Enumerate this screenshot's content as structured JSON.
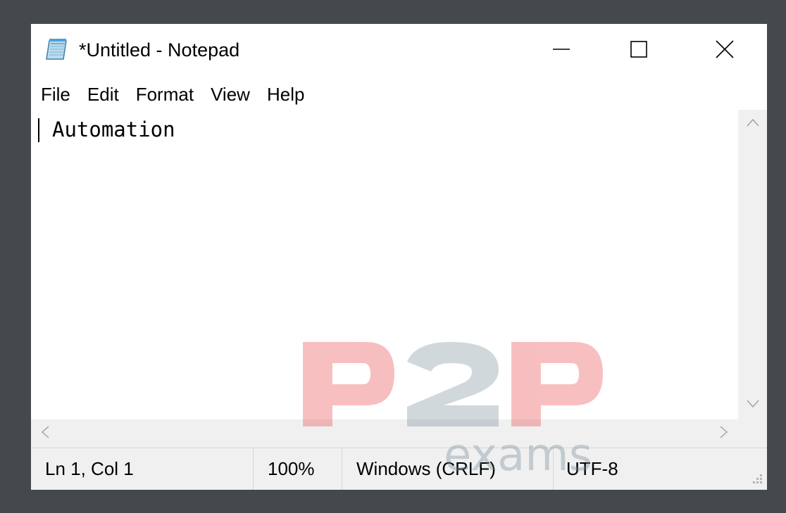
{
  "window": {
    "title": "*Untitled - Notepad"
  },
  "icons": {
    "app": "notepad-icon",
    "minimize": "minimize-icon",
    "maximize": "maximize-icon",
    "close": "close-icon",
    "scroll_up": "chevron-up-icon",
    "scroll_down": "chevron-down-icon",
    "scroll_left": "chevron-left-icon",
    "scroll_right": "chevron-right-icon",
    "grip": "resize-grip-icon"
  },
  "menu": {
    "items": [
      "File",
      "Edit",
      "Format",
      "View",
      "Help"
    ]
  },
  "editor": {
    "content": "Automation"
  },
  "status": {
    "position": "Ln 1, Col 1",
    "zoom": "100%",
    "line_ending": "Windows (CRLF)",
    "encoding": "UTF-8"
  },
  "watermark": {
    "logo": "P2P",
    "sub": "exams",
    "colors": {
      "red": "#e8383d",
      "slate": "#6f8796"
    }
  }
}
